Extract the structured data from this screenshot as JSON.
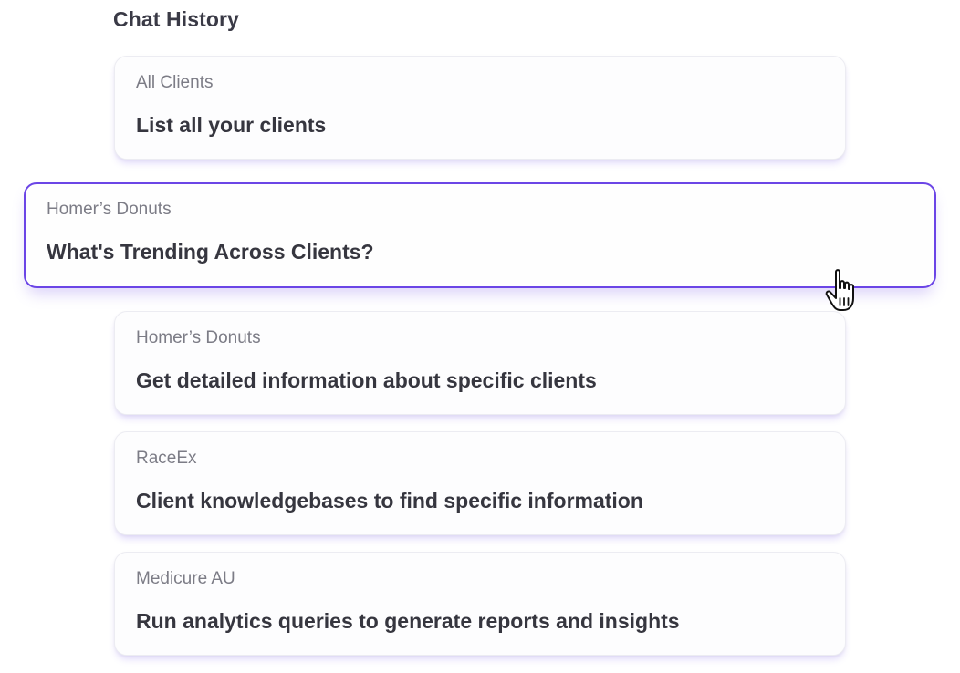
{
  "heading": "Chat History",
  "chats": [
    {
      "client": "All Clients",
      "title": "List all your clients"
    },
    {
      "client": "Homer’s Donuts",
      "title": "What's Trending Across Clients?"
    },
    {
      "client": "Homer’s Donuts",
      "title": "Get detailed information about specific clients"
    },
    {
      "client": "RaceEx",
      "title": "Client knowledgebases to find specific information"
    },
    {
      "client": "Medicure AU",
      "title": "Run analytics queries to generate reports and insights"
    }
  ],
  "cursor_icon": "hand-pointer-icon",
  "colors": {
    "accent": "#6b45e6",
    "shadow": "#7c5ceb",
    "text": "#36363f",
    "muted": "#7c7c86"
  }
}
